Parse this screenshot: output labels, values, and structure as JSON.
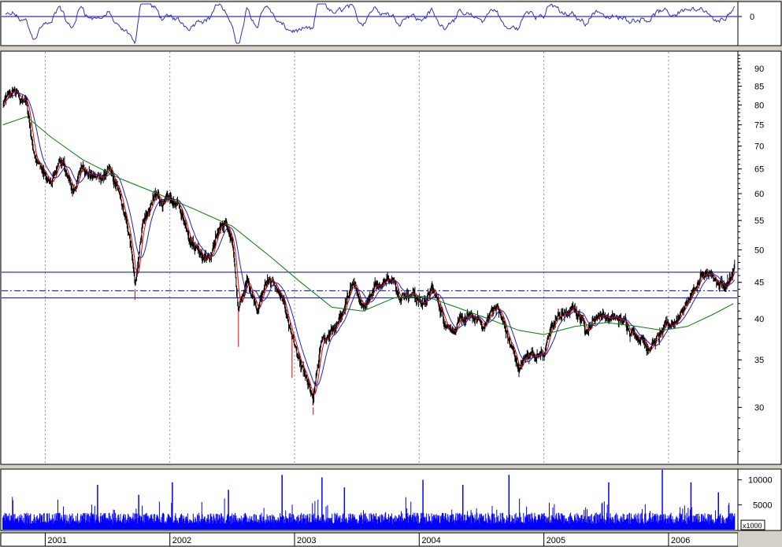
{
  "chart_data": [
    {
      "panel": "oscillator",
      "type": "line",
      "yticks": [
        "0"
      ],
      "zero_line": true,
      "line_color": "#3030c0"
    },
    {
      "panel": "price",
      "type": "candlestick",
      "scale": "log",
      "ylim": [
        25,
        95
      ],
      "yticks": [
        "30",
        "35",
        "40",
        "45",
        "50",
        "55",
        "60",
        "65",
        "70",
        "75",
        "80",
        "85",
        "90"
      ],
      "grid": "vertical dotted at year boundaries",
      "colors": {
        "bars": "#000000",
        "ma_short": "#e00000",
        "ma_mid": "#2020c0",
        "ma_long": "#008000",
        "hlines": "#0000c0"
      },
      "horizontal_lines": [
        {
          "value": 46.5,
          "style": "solid"
        },
        {
          "value": 43.8,
          "style": "dash-dot"
        },
        {
          "value": 42.8,
          "style": "solid"
        }
      ],
      "price_path": [
        {
          "x": 2000.66,
          "y": 80
        },
        {
          "x": 2000.75,
          "y": 83
        },
        {
          "x": 2000.85,
          "y": 80
        },
        {
          "x": 2000.9,
          "y": 70
        },
        {
          "x": 2000.98,
          "y": 65
        },
        {
          "x": 2001.05,
          "y": 61
        },
        {
          "x": 2001.12,
          "y": 67
        },
        {
          "x": 2001.22,
          "y": 60
        },
        {
          "x": 2001.3,
          "y": 66
        },
        {
          "x": 2001.42,
          "y": 63
        },
        {
          "x": 2001.52,
          "y": 65
        },
        {
          "x": 2001.58,
          "y": 60
        },
        {
          "x": 2001.68,
          "y": 51
        },
        {
          "x": 2001.72,
          "y": 44
        },
        {
          "x": 2001.78,
          "y": 55
        },
        {
          "x": 2001.88,
          "y": 59
        },
        {
          "x": 2001.98,
          "y": 58
        },
        {
          "x": 2002.05,
          "y": 58
        },
        {
          "x": 2002.18,
          "y": 52
        },
        {
          "x": 2002.32,
          "y": 49
        },
        {
          "x": 2002.4,
          "y": 54
        },
        {
          "x": 2002.5,
          "y": 52
        },
        {
          "x": 2002.55,
          "y": 41
        },
        {
          "x": 2002.62,
          "y": 45
        },
        {
          "x": 2002.7,
          "y": 42
        },
        {
          "x": 2002.8,
          "y": 46
        },
        {
          "x": 2002.88,
          "y": 43
        },
        {
          "x": 2002.98,
          "y": 38
        },
        {
          "x": 2003.05,
          "y": 34
        },
        {
          "x": 2003.15,
          "y": 30
        },
        {
          "x": 2003.22,
          "y": 37
        },
        {
          "x": 2003.35,
          "y": 39
        },
        {
          "x": 2003.45,
          "y": 44
        },
        {
          "x": 2003.55,
          "y": 42
        },
        {
          "x": 2003.65,
          "y": 45
        },
        {
          "x": 2003.75,
          "y": 46
        },
        {
          "x": 2003.85,
          "y": 44
        },
        {
          "x": 2003.95,
          "y": 44
        },
        {
          "x": 2004.02,
          "y": 42
        },
        {
          "x": 2004.1,
          "y": 44
        },
        {
          "x": 2004.2,
          "y": 40
        },
        {
          "x": 2004.3,
          "y": 39
        },
        {
          "x": 2004.4,
          "y": 40
        },
        {
          "x": 2004.52,
          "y": 39
        },
        {
          "x": 2004.62,
          "y": 42
        },
        {
          "x": 2004.72,
          "y": 37
        },
        {
          "x": 2004.8,
          "y": 34
        },
        {
          "x": 2004.9,
          "y": 36
        },
        {
          "x": 2005.0,
          "y": 36
        },
        {
          "x": 2005.1,
          "y": 40
        },
        {
          "x": 2005.25,
          "y": 41
        },
        {
          "x": 2005.35,
          "y": 39
        },
        {
          "x": 2005.45,
          "y": 41
        },
        {
          "x": 2005.55,
          "y": 40
        },
        {
          "x": 2005.7,
          "y": 39
        },
        {
          "x": 2005.85,
          "y": 37
        },
        {
          "x": 2005.95,
          "y": 38
        },
        {
          "x": 2006.02,
          "y": 39
        },
        {
          "x": 2006.1,
          "y": 41
        },
        {
          "x": 2006.2,
          "y": 44
        },
        {
          "x": 2006.3,
          "y": 46
        },
        {
          "x": 2006.4,
          "y": 44
        },
        {
          "x": 2006.48,
          "y": 45
        },
        {
          "x": 2006.52,
          "y": 46.5
        }
      ],
      "ma_long_path": [
        {
          "x": 2000.66,
          "y": 75
        },
        {
          "x": 2000.85,
          "y": 77
        },
        {
          "x": 2001.05,
          "y": 72
        },
        {
          "x": 2001.3,
          "y": 67
        },
        {
          "x": 2001.6,
          "y": 63
        },
        {
          "x": 2001.9,
          "y": 60
        },
        {
          "x": 2002.2,
          "y": 57
        },
        {
          "x": 2002.5,
          "y": 54
        },
        {
          "x": 2002.8,
          "y": 49
        },
        {
          "x": 2003.05,
          "y": 45
        },
        {
          "x": 2003.3,
          "y": 41.5
        },
        {
          "x": 2003.55,
          "y": 41
        },
        {
          "x": 2003.8,
          "y": 42.8
        },
        {
          "x": 2004.05,
          "y": 43
        },
        {
          "x": 2004.3,
          "y": 41.5
        },
        {
          "x": 2004.55,
          "y": 40
        },
        {
          "x": 2004.8,
          "y": 38.5
        },
        {
          "x": 2005.0,
          "y": 38
        },
        {
          "x": 2005.25,
          "y": 39
        },
        {
          "x": 2005.5,
          "y": 39.5
        },
        {
          "x": 2005.75,
          "y": 39
        },
        {
          "x": 2005.95,
          "y": 38.5
        },
        {
          "x": 2006.15,
          "y": 39
        },
        {
          "x": 2006.35,
          "y": 40.5
        },
        {
          "x": 2006.52,
          "y": 42
        }
      ]
    },
    {
      "panel": "volume",
      "type": "bar",
      "yticks": [
        "5000",
        "10000"
      ],
      "unit_label": "x1000",
      "ylim": [
        0,
        12000
      ],
      "bar_color": "#0000ff"
    }
  ],
  "xaxis": {
    "years": [
      "2001",
      "2002",
      "2003",
      "2004",
      "2005",
      "2006"
    ]
  },
  "year_positions": [
    2001,
    2002,
    2003,
    2004,
    2005,
    2006
  ],
  "volume_spikes": [
    {
      "x": 2001.42,
      "v": 9000
    },
    {
      "x": 2001.75,
      "v": 7000
    },
    {
      "x": 2002.02,
      "v": 9500
    },
    {
      "x": 2002.47,
      "v": 8000
    },
    {
      "x": 2002.9,
      "v": 11000
    },
    {
      "x": 2003.22,
      "v": 10500
    },
    {
      "x": 2003.4,
      "v": 8500
    },
    {
      "x": 2004.03,
      "v": 10000
    },
    {
      "x": 2004.35,
      "v": 9000
    },
    {
      "x": 2004.72,
      "v": 11000
    },
    {
      "x": 2005.52,
      "v": 9500
    },
    {
      "x": 2005.95,
      "v": 12000
    },
    {
      "x": 2006.18,
      "v": 9500
    },
    {
      "x": 2006.4,
      "v": 7500
    }
  ]
}
